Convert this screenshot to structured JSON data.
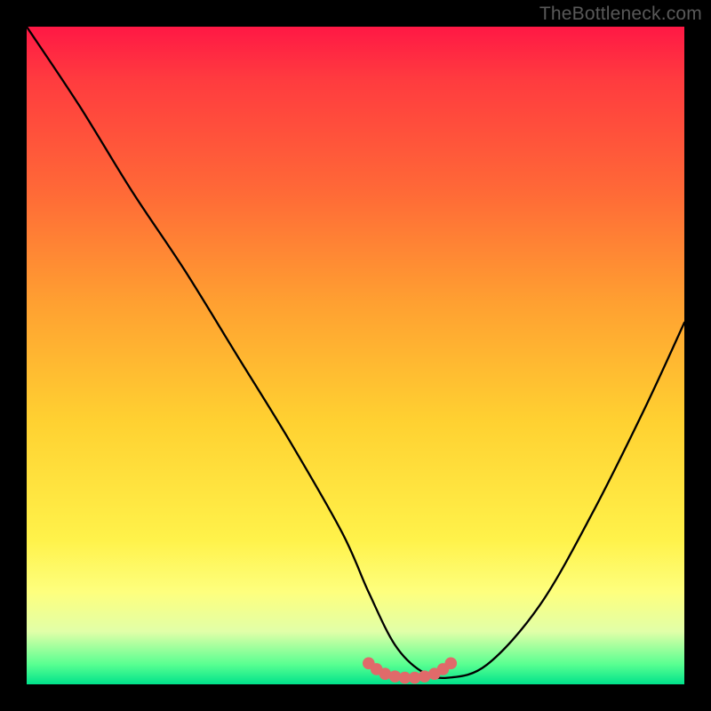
{
  "watermark": "TheBottleneck.com",
  "colors": {
    "page_bg": "#000000",
    "watermark": "#595959",
    "curve": "#000000",
    "marker_fill": "#e06a6a",
    "marker_stroke": "#d24f4f"
  },
  "chart_data": {
    "type": "line",
    "title": "",
    "xlabel": "",
    "ylabel": "",
    "xlim": [
      0,
      100
    ],
    "ylim": [
      0,
      100
    ],
    "grid": false,
    "series": [
      {
        "name": "main-curve",
        "x": [
          0,
          8,
          16,
          24,
          32,
          40,
          48,
          52,
          56,
          60,
          64,
          70,
          78,
          86,
          94,
          100
        ],
        "y": [
          100,
          88,
          75,
          63,
          50,
          37,
          23,
          14,
          6,
          2,
          1,
          3,
          12,
          26,
          42,
          55
        ]
      }
    ],
    "markers": {
      "name": "bottom-points",
      "x": [
        52.0,
        53.2,
        54.5,
        56.0,
        57.5,
        59.0,
        60.5,
        62.0,
        63.3,
        64.5
      ],
      "y": [
        3.2,
        2.3,
        1.6,
        1.2,
        1.0,
        1.0,
        1.2,
        1.6,
        2.3,
        3.2
      ]
    }
  }
}
